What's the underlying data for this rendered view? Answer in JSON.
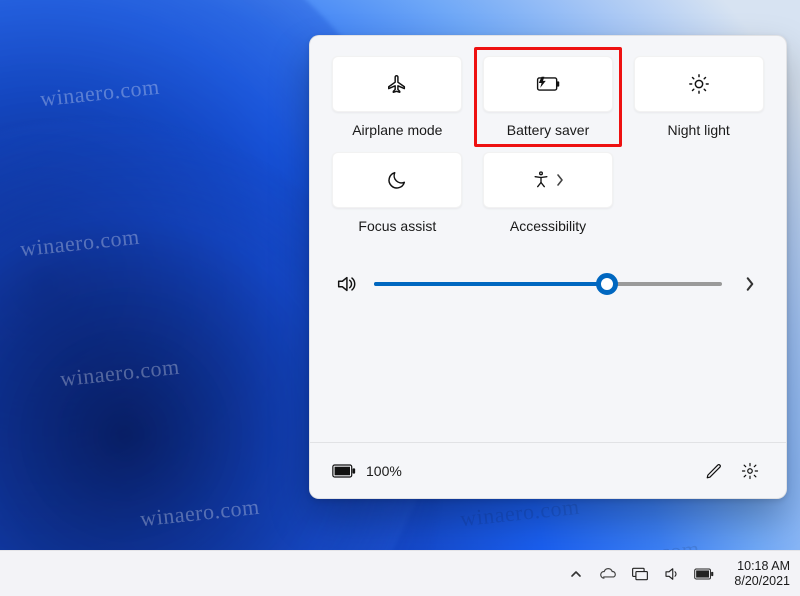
{
  "watermark": "winaero.com",
  "flyout": {
    "tiles": [
      {
        "id": "airplane-mode",
        "label": "Airplane mode",
        "icon": "airplane-icon"
      },
      {
        "id": "battery-saver",
        "label": "Battery saver",
        "icon": "battery-saver-icon",
        "highlighted": true
      },
      {
        "id": "night-light",
        "label": "Night light",
        "icon": "night-light-icon"
      },
      {
        "id": "focus-assist",
        "label": "Focus assist",
        "icon": "moon-icon"
      },
      {
        "id": "accessibility",
        "label": "Accessibility",
        "icon": "accessibility-icon",
        "hasChevron": true
      }
    ],
    "volume": {
      "percent": 67
    },
    "battery": {
      "text": "100%"
    }
  },
  "taskbar": {
    "time": "10:18 AM",
    "date": "8/20/2021"
  },
  "colors": {
    "accent": "#0067c0",
    "highlight": "#e11"
  }
}
